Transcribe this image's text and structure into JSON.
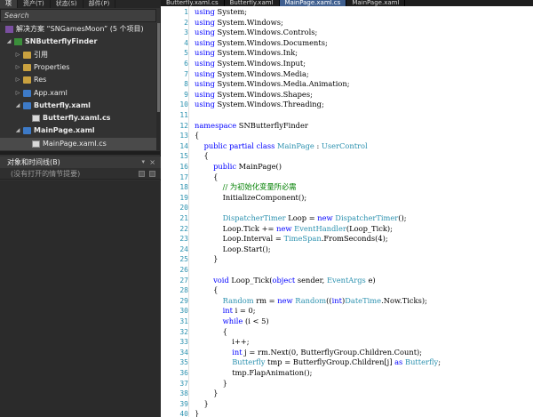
{
  "left_panel": {
    "tabs": [
      "项",
      "资产(T)",
      "状态(S)",
      "部件(P)"
    ],
    "search_placeholder": "Search",
    "tree": [
      {
        "label": "解决方案 “SNGamesMoon” (5 个项目)",
        "icon": "solution-icon",
        "arrow": ""
      },
      {
        "label": "SNButterflyFinder",
        "icon": "project-icon",
        "arrow": "◢",
        "bold": true
      },
      {
        "label": "引用",
        "icon": "folder-icon",
        "arrow": "▷"
      },
      {
        "label": "Properties",
        "icon": "folder-icon",
        "arrow": "▷"
      },
      {
        "label": "Res",
        "icon": "folder-icon",
        "arrow": "▷"
      },
      {
        "label": "App.xaml",
        "icon": "xaml-file-icon",
        "arrow": "▷"
      },
      {
        "label": "Butterfly.xaml",
        "icon": "xaml-file-icon",
        "arrow": "◢",
        "bold": true
      },
      {
        "label": "Butterfly.xaml.cs",
        "icon": "cs-file-icon",
        "arrow": "",
        "bold": true
      },
      {
        "label": "MainPage.xaml",
        "icon": "xaml-file-icon",
        "arrow": "◢",
        "bold": true
      },
      {
        "label": "MainPage.xaml.cs",
        "icon": "cs-file-icon",
        "arrow": "",
        "selected": true
      }
    ],
    "objects_header": "对象和时间线(B)",
    "objects_sub": "(没有打开的情节提要)"
  },
  "doc_tabs": [
    {
      "label": "Butterfly.xaml.cs",
      "active": false
    },
    {
      "label": "Butterfly.xaml",
      "active": false
    },
    {
      "label": "MainPage.xaml.cs",
      "active": true
    },
    {
      "label": "MainPage.xaml",
      "active": false
    }
  ],
  "code_lines": [
    [
      {
        "t": "k",
        "s": "using"
      },
      {
        "s": " System;"
      }
    ],
    [
      {
        "t": "k",
        "s": "using"
      },
      {
        "s": " System.Windows;"
      }
    ],
    [
      {
        "t": "k",
        "s": "using"
      },
      {
        "s": " System.Windows.Controls;"
      }
    ],
    [
      {
        "t": "k",
        "s": "using"
      },
      {
        "s": " System.Windows.Documents;"
      }
    ],
    [
      {
        "t": "k",
        "s": "using"
      },
      {
        "s": " System.Windows.Ink;"
      }
    ],
    [
      {
        "t": "k",
        "s": "using"
      },
      {
        "s": " System.Windows.Input;"
      }
    ],
    [
      {
        "t": "k",
        "s": "using"
      },
      {
        "s": " System.Windows.Media;"
      }
    ],
    [
      {
        "t": "k",
        "s": "using"
      },
      {
        "s": " System.Windows.Media.Animation;"
      }
    ],
    [
      {
        "t": "k",
        "s": "using"
      },
      {
        "s": " System.Windows.Shapes;"
      }
    ],
    [
      {
        "t": "k",
        "s": "using"
      },
      {
        "s": " System.Windows.Threading;"
      }
    ],
    [],
    [
      {
        "t": "k",
        "s": "namespace"
      },
      {
        "s": " SNButterflyFinder"
      }
    ],
    [
      {
        "s": "{"
      }
    ],
    [
      {
        "s": "    "
      },
      {
        "t": "k",
        "s": "public"
      },
      {
        "s": " "
      },
      {
        "t": "k",
        "s": "partial"
      },
      {
        "s": " "
      },
      {
        "t": "k",
        "s": "class"
      },
      {
        "s": " "
      },
      {
        "t": "t",
        "s": "MainPage"
      },
      {
        "s": " : "
      },
      {
        "t": "t",
        "s": "UserControl"
      }
    ],
    [
      {
        "s": "    {"
      }
    ],
    [
      {
        "s": "        "
      },
      {
        "t": "k",
        "s": "public"
      },
      {
        "s": " MainPage()"
      }
    ],
    [
      {
        "s": "        {"
      }
    ],
    [
      {
        "s": "            "
      },
      {
        "t": "c",
        "s": "// 为初始化变量所必需"
      }
    ],
    [
      {
        "s": "            InitializeComponent();"
      }
    ],
    [],
    [
      {
        "s": "            "
      },
      {
        "t": "t",
        "s": "DispatcherTimer"
      },
      {
        "s": " Loop = "
      },
      {
        "t": "k",
        "s": "new"
      },
      {
        "s": " "
      },
      {
        "t": "t",
        "s": "DispatcherTimer"
      },
      {
        "s": "();"
      }
    ],
    [
      {
        "s": "            Loop.Tick += "
      },
      {
        "t": "k",
        "s": "new"
      },
      {
        "s": " "
      },
      {
        "t": "t",
        "s": "EventHandler"
      },
      {
        "s": "(Loop_Tick);"
      }
    ],
    [
      {
        "s": "            Loop.Interval = "
      },
      {
        "t": "t",
        "s": "TimeSpan"
      },
      {
        "s": ".FromSeconds(4);"
      }
    ],
    [
      {
        "s": "            Loop.Start();"
      }
    ],
    [
      {
        "s": "        }"
      }
    ],
    [],
    [
      {
        "s": "        "
      },
      {
        "t": "k",
        "s": "void"
      },
      {
        "s": " Loop_Tick("
      },
      {
        "t": "k",
        "s": "object"
      },
      {
        "s": " sender, "
      },
      {
        "t": "t",
        "s": "EventArgs"
      },
      {
        "s": " e)"
      }
    ],
    [
      {
        "s": "        {"
      }
    ],
    [
      {
        "s": "            "
      },
      {
        "t": "t",
        "s": "Random"
      },
      {
        "s": " rm = "
      },
      {
        "t": "k",
        "s": "new"
      },
      {
        "s": " "
      },
      {
        "t": "t",
        "s": "Random"
      },
      {
        "s": "(("
      },
      {
        "t": "k",
        "s": "int"
      },
      {
        "s": ")"
      },
      {
        "t": "t",
        "s": "DateTime"
      },
      {
        "s": ".Now.Ticks);"
      }
    ],
    [
      {
        "s": "            "
      },
      {
        "t": "k",
        "s": "int"
      },
      {
        "s": " i = 0;"
      }
    ],
    [
      {
        "s": "            "
      },
      {
        "t": "k",
        "s": "while"
      },
      {
        "s": " (i < 5)"
      }
    ],
    [
      {
        "s": "            {"
      }
    ],
    [
      {
        "s": "                i++;"
      }
    ],
    [
      {
        "s": "                "
      },
      {
        "t": "k",
        "s": "int"
      },
      {
        "s": " j = rm.Next(0, ButterflyGroup.Children.Count);"
      }
    ],
    [
      {
        "s": "                "
      },
      {
        "t": "t",
        "s": "Butterfly"
      },
      {
        "s": " tmp = ButterflyGroup.Children[j] "
      },
      {
        "t": "k",
        "s": "as"
      },
      {
        "s": " "
      },
      {
        "t": "t",
        "s": "Butterfly"
      },
      {
        "s": ";"
      }
    ],
    [
      {
        "s": "                tmp.FlapAnimation();"
      }
    ],
    [
      {
        "s": "            }"
      }
    ],
    [
      {
        "s": "        }"
      }
    ],
    [
      {
        "s": "    }"
      }
    ],
    [
      {
        "s": "}"
      }
    ]
  ],
  "line_numbers": [
    1,
    2,
    3,
    4,
    5,
    6,
    7,
    8,
    9,
    10,
    11,
    12,
    13,
    14,
    15,
    16,
    17,
    18,
    19,
    20,
    21,
    22,
    23,
    24,
    25,
    26,
    27,
    28,
    29,
    30,
    31,
    32,
    33,
    34,
    35,
    36,
    37,
    38,
    39,
    40
  ]
}
